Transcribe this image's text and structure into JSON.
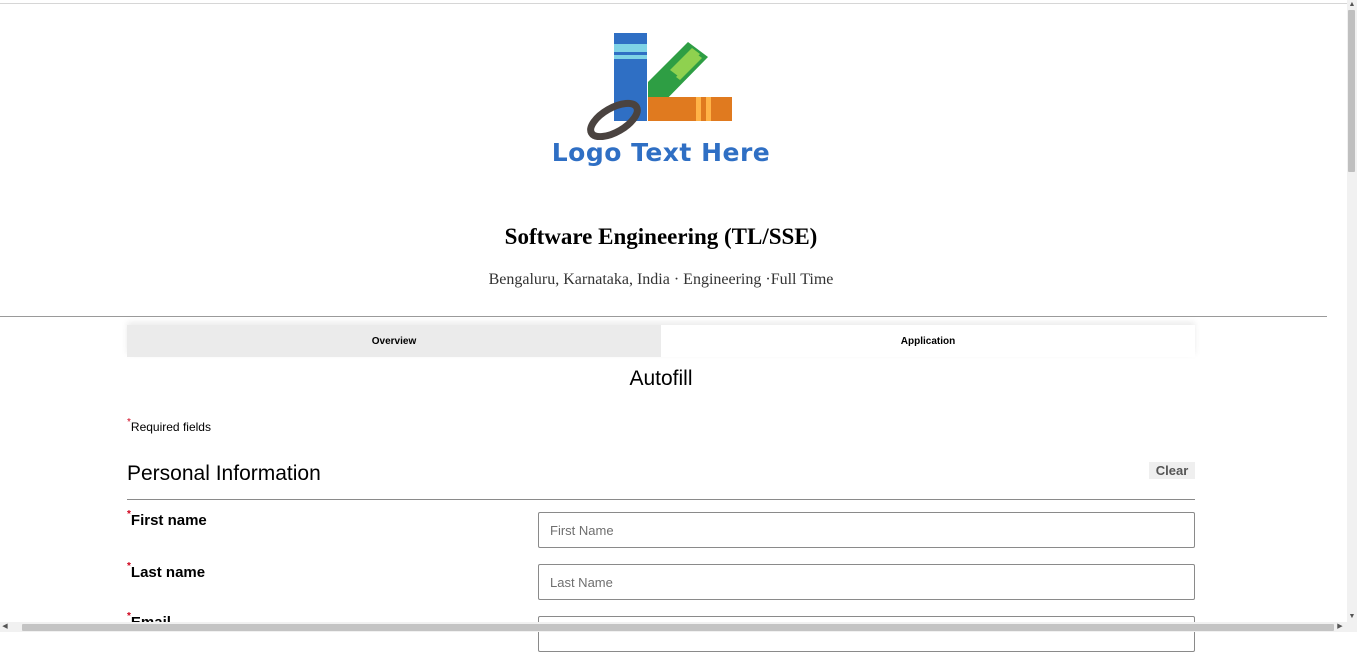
{
  "logo": {
    "text": "Logo Text Here"
  },
  "job": {
    "title": "Software Engineering (TL/SSE)",
    "meta": "Bengaluru, Karnataka, India · Engineering ·Full Time"
  },
  "tabs": [
    {
      "label": "Overview",
      "active": false
    },
    {
      "label": "Application",
      "active": true
    }
  ],
  "autofill": {
    "title": "Autofill"
  },
  "required_note": {
    "marker": "*",
    "text": "Required fields"
  },
  "section": {
    "title": "Personal Information",
    "clear_label": "Clear"
  },
  "fields": [
    {
      "label": "First name",
      "required": true,
      "placeholder": "First Name",
      "value": ""
    },
    {
      "label": "Last name",
      "required": true,
      "placeholder": "Last Name",
      "value": ""
    },
    {
      "label": "Email",
      "required": true,
      "placeholder": "",
      "value": ""
    }
  ],
  "icons": {
    "scroll_up": "triangle-up-icon",
    "scroll_down": "triangle-down-icon",
    "scroll_left": "triangle-left-icon",
    "scroll_right": "triangle-right-icon"
  },
  "colors": {
    "required_marker": "#d0021b",
    "logo_blue": "#2f6fc4",
    "logo_green": "#2e9e44",
    "logo_orange": "#e07a1f",
    "tab_inactive": "#ebebeb"
  }
}
